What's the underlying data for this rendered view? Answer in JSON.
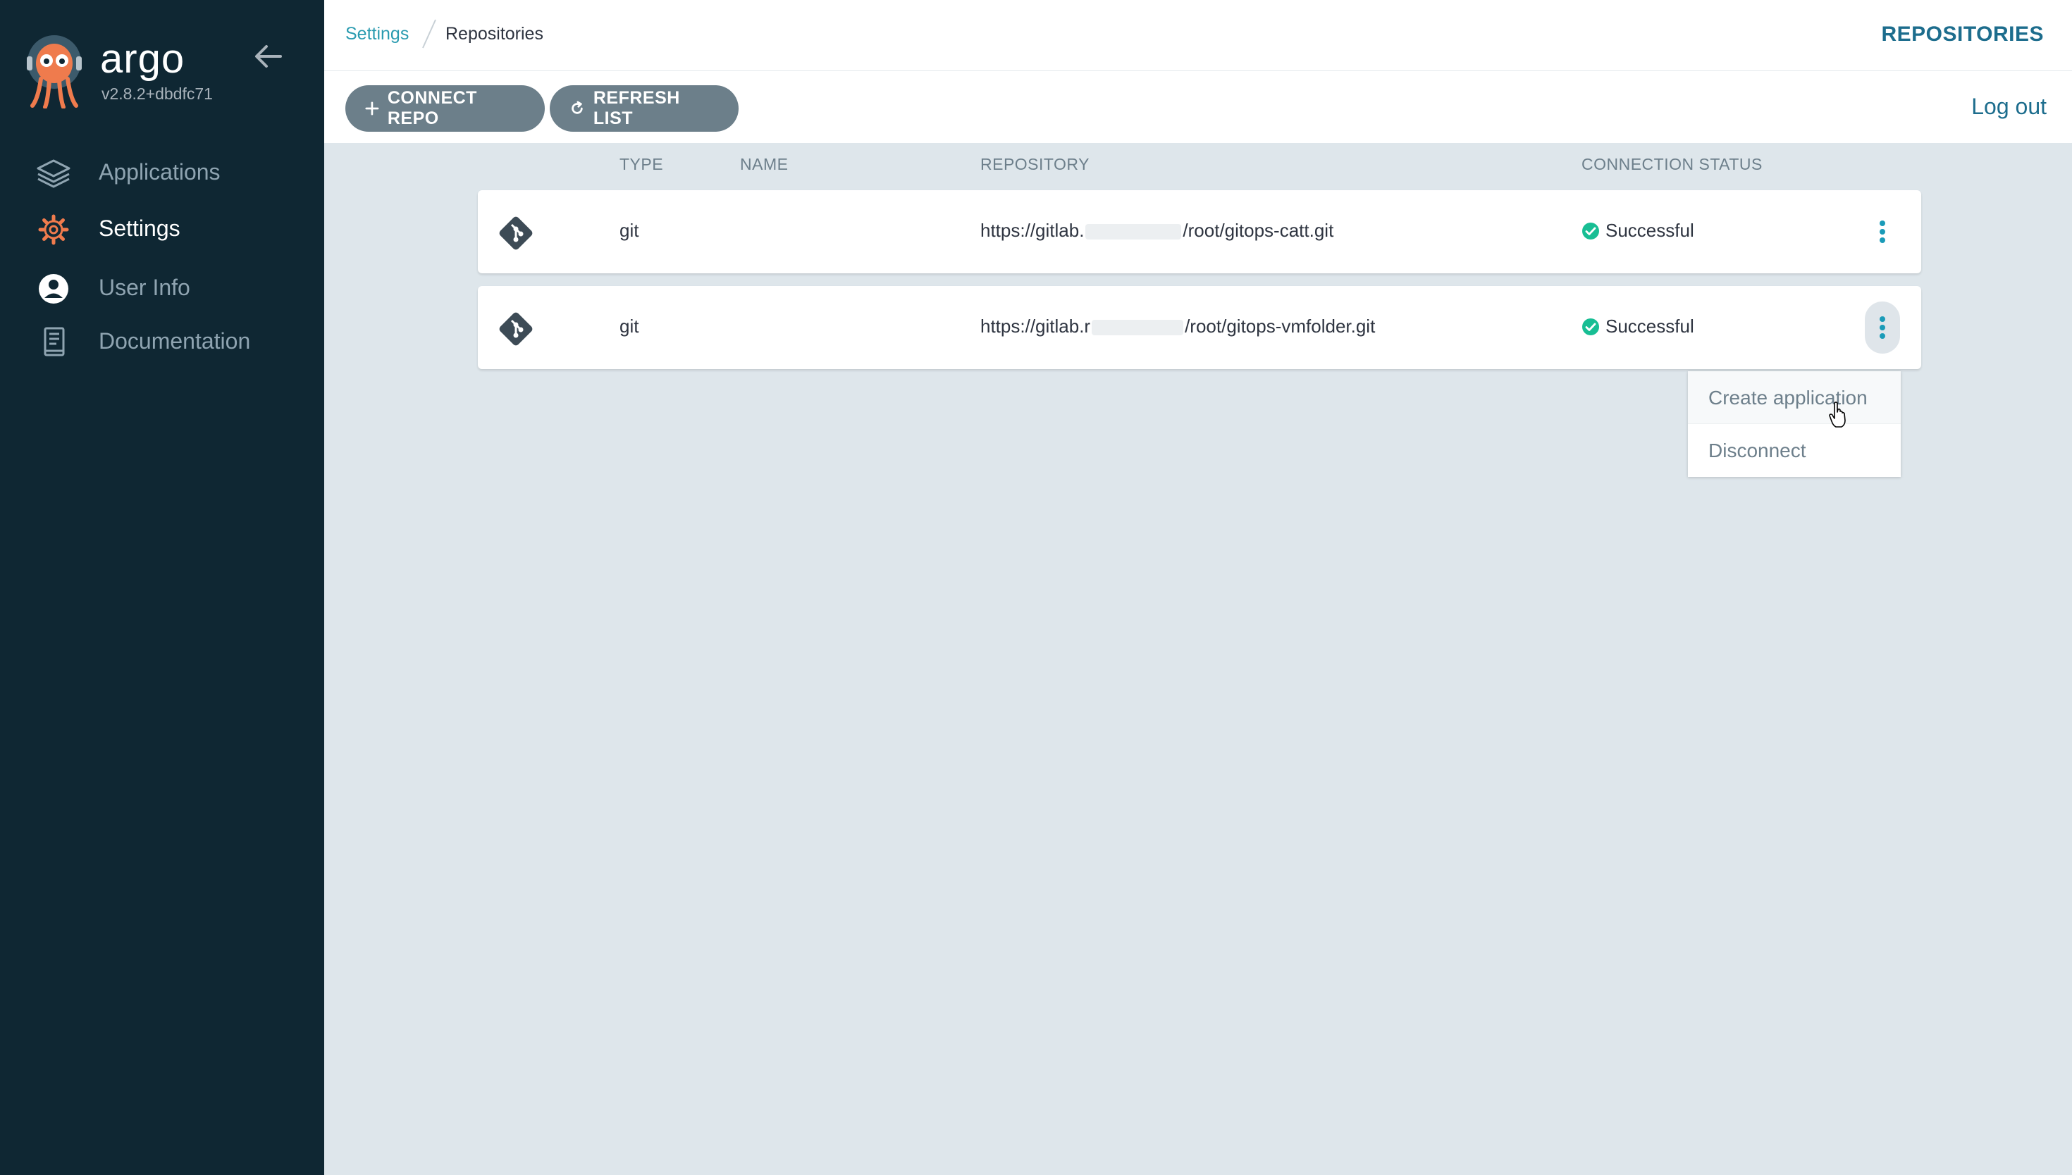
{
  "app": {
    "name": "argo",
    "version": "v2.8.2+dbdfc71"
  },
  "sidebar": {
    "items": [
      {
        "label": "Applications",
        "icon": "layers-icon",
        "active": false
      },
      {
        "label": "Settings",
        "icon": "gear-icon",
        "active": true
      },
      {
        "label": "User Info",
        "icon": "user-icon",
        "active": false
      },
      {
        "label": "Documentation",
        "icon": "book-icon",
        "active": false
      }
    ]
  },
  "header": {
    "breadcrumb": {
      "parent": "Settings",
      "current": "Repositories"
    },
    "title": "REPOSITORIES"
  },
  "toolbar": {
    "connect_label": "CONNECT REPO",
    "refresh_label": "REFRESH LIST",
    "logout_label": "Log out"
  },
  "table": {
    "columns": {
      "type": "TYPE",
      "name": "NAME",
      "repository": "REPOSITORY",
      "status": "CONNECTION STATUS"
    },
    "rows": [
      {
        "type": "git",
        "name": "",
        "repo_prefix": "https://gitlab.",
        "repo_suffix": "/root/gitops-catt.git",
        "status": "Successful"
      },
      {
        "type": "git",
        "name": "",
        "repo_prefix": "https://gitlab.r",
        "repo_suffix": "/root/gitops-vmfolder.git",
        "status": "Successful"
      }
    ]
  },
  "context_menu": {
    "items": [
      "Create application",
      "Disconnect"
    ]
  },
  "colors": {
    "sidebar_bg": "#0f2733",
    "accent": "#2a9bb0",
    "success": "#18be94",
    "button_bg": "#6c7f8a",
    "logo_orange": "#ef7b4d"
  }
}
